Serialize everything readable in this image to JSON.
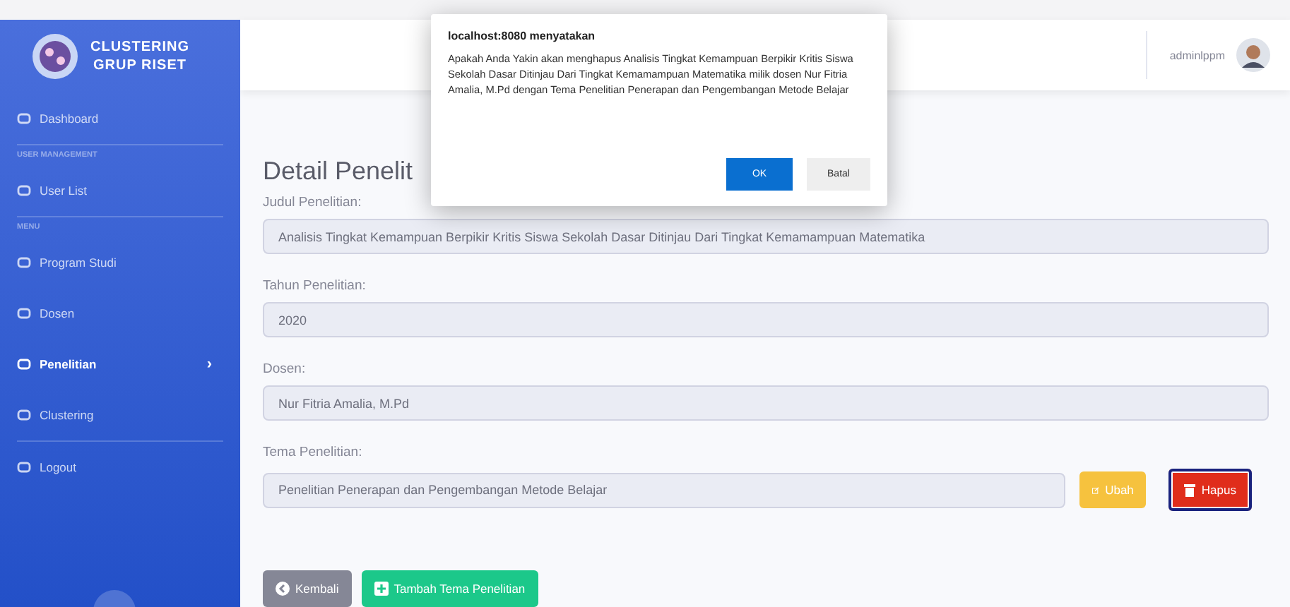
{
  "sidebar": {
    "brand": [
      "CLUSTERING",
      "GRUP RISET"
    ],
    "items": [
      {
        "kind": "link",
        "label": "Dashboard",
        "selected": false,
        "divider_after": true
      },
      {
        "kind": "heading",
        "label": "USER MANAGEMENT"
      },
      {
        "kind": "link",
        "label": "User List",
        "selected": false,
        "divider_after": true
      },
      {
        "kind": "heading",
        "label": "MENU"
      },
      {
        "kind": "link",
        "label": "Program Studi",
        "selected": false
      },
      {
        "kind": "link",
        "label": "Dosen",
        "selected": false
      },
      {
        "kind": "link",
        "label": "Penelitian",
        "selected": true,
        "chevron": "›"
      },
      {
        "kind": "link",
        "label": "Clustering",
        "selected": false,
        "divider_after": true
      },
      {
        "kind": "link",
        "label": "Logout",
        "selected": false
      }
    ]
  },
  "topbar": {
    "username": "adminlppm"
  },
  "page": {
    "title": "Detail Penelit",
    "fields": [
      {
        "label": "Judul Penelitian:",
        "value": "Analisis Tingkat Kemampuan Berpikir Kritis Siswa Sekolah Dasar Ditinjau Dari Tingkat Kemamampuan Matematika"
      },
      {
        "label": "Tahun Penelitian:",
        "value": "2020"
      },
      {
        "label": "Dosen:",
        "value": "Nur Fitria Amalia, M.Pd"
      },
      {
        "label": "Tema Penelitian:",
        "value": "Penelitian Penerapan dan Pengembangan Metode Belajar",
        "actions": [
          {
            "kind": "edit",
            "label": "Ubah"
          },
          {
            "kind": "delete",
            "label": "Hapus",
            "focused": true
          }
        ]
      }
    ],
    "buttons": [
      {
        "kind": "back",
        "label": "Kembali"
      },
      {
        "kind": "add",
        "label": "Tambah Tema Penelitian"
      }
    ]
  },
  "dialog": {
    "title": "localhost:8080 menyatakan",
    "message": "Apakah Anda Yakin akan menghapus Analisis Tingkat Kemampuan Berpikir Kritis Siswa Sekolah Dasar Ditinjau Dari Tingkat Kemamampuan Matematika  milik dosen Nur Fitria Amalia, M.Pd dengan Tema Penelitian Penerapan dan Pengembangan Metode Belajar",
    "buttons": [
      {
        "kind": "primary",
        "label": "OK"
      },
      {
        "kind": "secondary",
        "label": "Batal"
      }
    ]
  }
}
